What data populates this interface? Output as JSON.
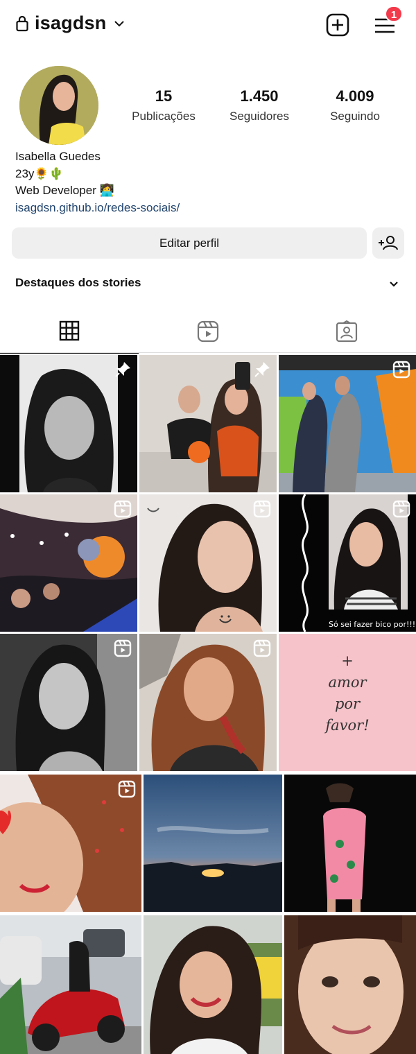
{
  "header": {
    "username": "isagdsn",
    "notification_count": "1"
  },
  "profile": {
    "stats": [
      {
        "value": "15",
        "label": "Publicações"
      },
      {
        "value": "1.450",
        "label": "Seguidores"
      },
      {
        "value": "4.009",
        "label": "Seguindo"
      }
    ],
    "bio": {
      "name": "Isabella Guedes",
      "line1": "23y🌻🌵",
      "line2": "Web Developer 👩‍💻",
      "link": "isagdsn.github.io/redes-sociais/"
    }
  },
  "actions": {
    "edit_label": "Editar perfil"
  },
  "highlights": {
    "label": "Destaques dos stories"
  },
  "tabs": [
    "posts-grid",
    "reels",
    "tagged"
  ],
  "grid": {
    "text_post": [
      "+",
      "amor",
      "por",
      "favor!"
    ],
    "reel_caption": "Só sei fazer bico por!!!"
  },
  "colors": {
    "badge": "#f23a4b",
    "link": "#21446d",
    "button_bg": "#efefef",
    "pink_post": "#f6c3ca"
  }
}
